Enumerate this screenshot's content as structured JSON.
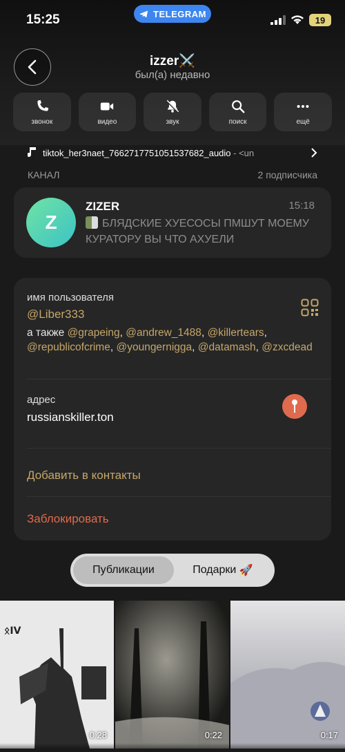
{
  "status_bar": {
    "time": "15:25",
    "telegram_label": "TELEGRAM",
    "battery": "19"
  },
  "header": {
    "title": "izzer",
    "title_emoji": "⚔️",
    "subtitle": "был(а) недавно"
  },
  "actions": [
    {
      "label": "звонок",
      "icon": "phone-icon"
    },
    {
      "label": "видео",
      "icon": "video-icon"
    },
    {
      "label": "звук",
      "icon": "bell-off-icon"
    },
    {
      "label": "поиск",
      "icon": "search-icon"
    },
    {
      "label": "ещё",
      "icon": "more-icon"
    }
  ],
  "audio": {
    "title": "tiktok_her3naet_7662717751051537682_audio",
    "suffix": " - <un"
  },
  "channel_section": {
    "label": "КАНАЛ",
    "subscribers": "2 подписчика"
  },
  "channel": {
    "avatar_letter": "Z",
    "name": "ZIZER",
    "time": "15:18",
    "message": "БЛЯДСКИЕ ХУЕСОСЫ ПМШУТ МОЕМУ КУРАТОРУ ВЫ ЧТО АХУЕЛИ"
  },
  "info": {
    "username_label": "имя пользователя",
    "username": "@Liber333",
    "also_prefix": "а также",
    "also_list": [
      "@grapeing",
      "@andrew_1488",
      "@killertears",
      "@republicofcrime",
      "@youngernigga",
      "@datamash",
      "@zxcdead"
    ],
    "address_label": "адрес",
    "address": "russianskiller.ton",
    "add_contact": "Добавить в контакты",
    "block": "Заблокировать"
  },
  "colors": {
    "gold": "#c5a76a",
    "red": "#e06a4d",
    "accent_blue": "#3d86f0"
  },
  "tabs": {
    "active": "Публикации",
    "other": "Подарки",
    "other_emoji": "🚀"
  },
  "media": [
    {
      "duration": "0:28"
    },
    {
      "duration": "0:22"
    },
    {
      "duration": "0:17"
    }
  ]
}
